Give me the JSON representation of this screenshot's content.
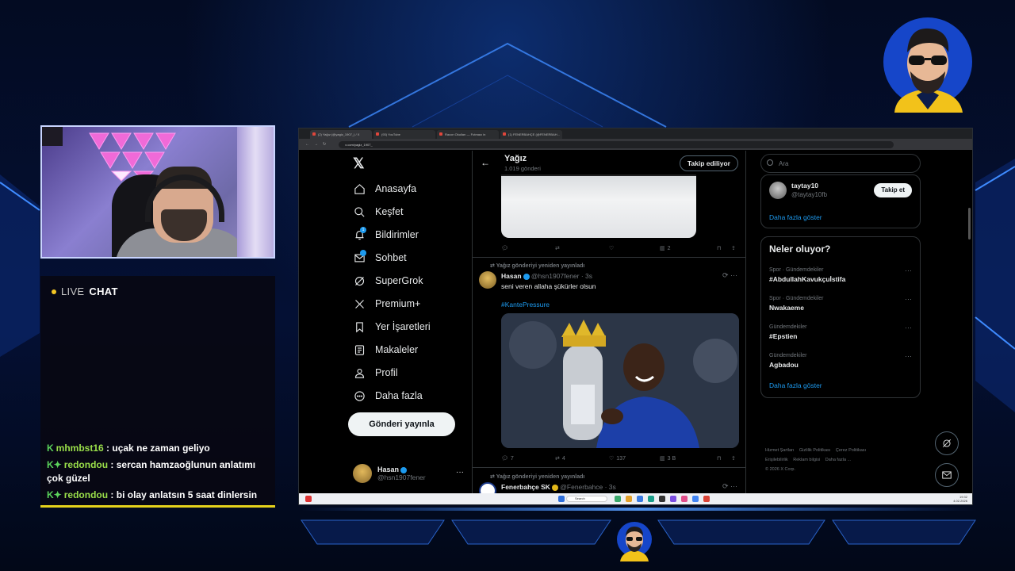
{
  "stream": {
    "live_chat_prefix": "LIVE",
    "live_chat_label": "CHAT",
    "chat_messages": [
      {
        "user": "mhmbst16",
        "text": ": uçak ne zaman geliyo"
      },
      {
        "user": "redondou",
        "text": ": sercan hamzaoğlunun anlatımı çok güzel"
      },
      {
        "user": "redondou",
        "text": ": bi olay anlatsın 5 saat dinlersin"
      }
    ]
  },
  "browser": {
    "tabs": [
      "(2) Yağız (@yagiz_1907_) / X",
      "(93) YouTube",
      "Racon Okulları — Futmacı in",
      "(1) FENERBAHÇE (@FENERBAH..."
    ],
    "address": "x.com/yagiz_1907_"
  },
  "nav": {
    "items": [
      "Anasayfa",
      "Keşfet",
      "Bildirimler",
      "Sohbet",
      "SuperGrok",
      "Premium+",
      "Yer İşaretleri",
      "Makaleler",
      "Profil",
      "Daha fazla"
    ],
    "notif_count": "1",
    "post_button": "Gönderi yayınla",
    "account_name": "Hasan",
    "account_handle": "@hsn1907fener"
  },
  "timeline": {
    "profile_name": "Yağız",
    "post_count": "1.019 gönderi",
    "following_button": "Takip ediliyor",
    "first_post_actions": {
      "views": "2"
    },
    "repost_label": "Yağız gönderiyi yeniden yayınladı",
    "tweet1": {
      "name": "Hasan",
      "handle": "@hsn1907fener · 3s",
      "text": "seni veren allaha şükürler olsun",
      "hashtag": "#KantePressure",
      "replies": "7",
      "reposts": "4",
      "likes": "137",
      "views": "3 B"
    },
    "tweet2": {
      "name": "Fenerbahçe SK",
      "handle": "@Fenerbahce · 3s"
    }
  },
  "sidebar": {
    "search_placeholder": "Ara",
    "follow": {
      "name": "taytay10",
      "handle": "@taytay10fb",
      "button": "Takip et"
    },
    "show_more": "Daha fazla göster",
    "trends_title": "Neler oluyor?",
    "trends": [
      {
        "category": "Spor · Gündemdekiler",
        "name": "#AbdullahKavukçuİstifa"
      },
      {
        "category": "Spor · Gündemdekiler",
        "name": "Nwakaeme"
      },
      {
        "category": "Gündemdekiler",
        "name": "#Epstien"
      },
      {
        "category": "Gündemdekiler",
        "name": "Agbadou"
      }
    ],
    "footer_links": [
      "Hizmet Şartları",
      "Gizlilik Politikası",
      "Çerez Politikası",
      "Erişilebilirlik",
      "Reklam bilgisi",
      "Daha fazla ..."
    ],
    "copyright": "© 2026 X Corp."
  },
  "taskbar": {
    "search": "Search",
    "clock_time": "19:32",
    "clock_date": "4.02.2026"
  }
}
